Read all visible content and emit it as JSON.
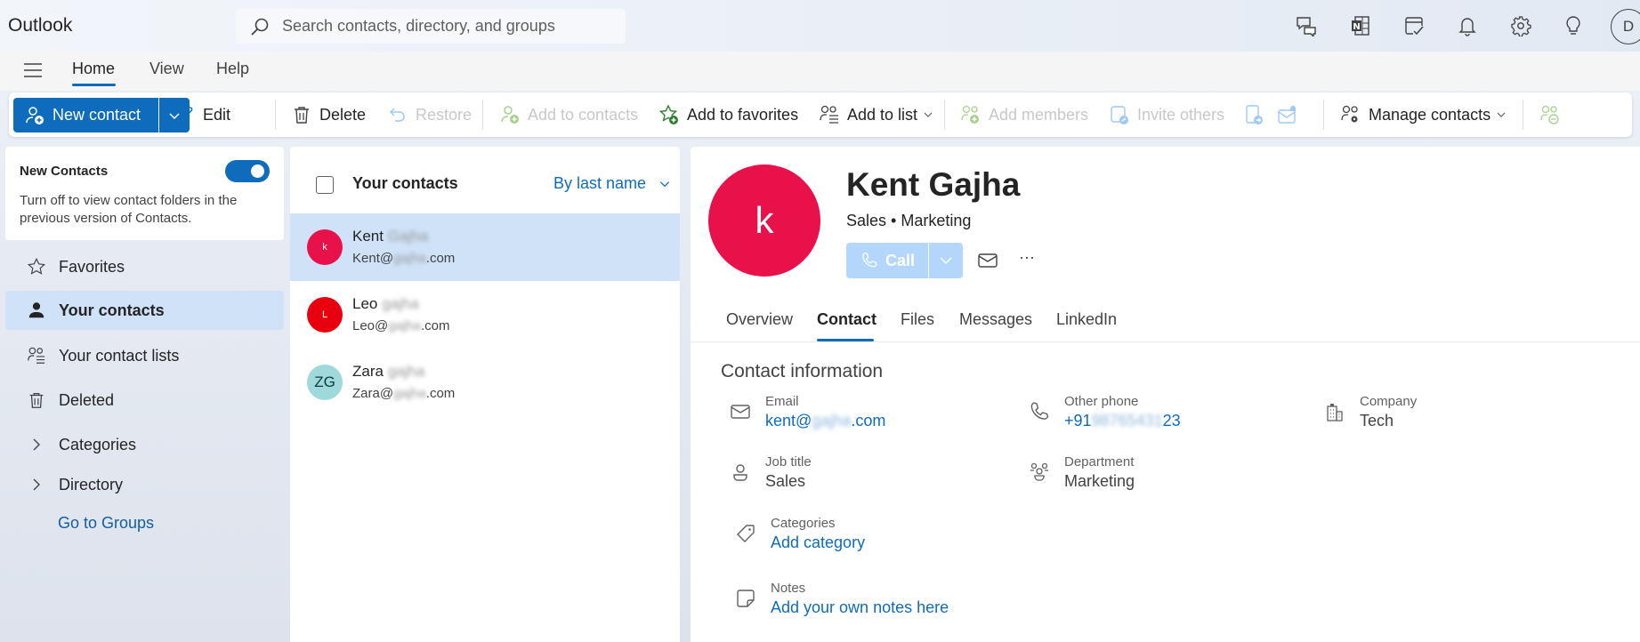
{
  "app": {
    "title": "Outlook"
  },
  "search": {
    "placeholder": "Search contacts, directory, and groups"
  },
  "top_icons": [
    "feedback-icon",
    "onenote-icon",
    "todo-icon",
    "bell-icon",
    "gear-icon",
    "lightbulb-icon"
  ],
  "account": {
    "initial": "D"
  },
  "ribbon_tabs": [
    {
      "label": "Home",
      "active": true
    },
    {
      "label": "View",
      "active": false
    },
    {
      "label": "Help",
      "active": false
    }
  ],
  "toolbar": {
    "new_contact": "New contact",
    "edit": "Edit",
    "delete": "Delete",
    "restore": "Restore",
    "add_to_contacts": "Add to contacts",
    "add_to_favorites": "Add to favorites",
    "add_to_list": "Add to list",
    "add_members": "Add members",
    "invite_others": "Invite others",
    "manage_contacts": "Manage contacts"
  },
  "sidebar": {
    "new_contacts": {
      "title": "New Contacts",
      "description": "Turn off to view contact folders in the previous version of Contacts.",
      "enabled": true
    },
    "items": [
      {
        "label": "Favorites",
        "icon": "star-icon"
      },
      {
        "label": "Your contacts",
        "icon": "person-icon",
        "active": true
      },
      {
        "label": "Your contact lists",
        "icon": "contact-list-icon"
      },
      {
        "label": "Deleted",
        "icon": "trash-icon"
      },
      {
        "label": "Categories",
        "icon": "chevron-right-icon"
      },
      {
        "label": "Directory",
        "icon": "chevron-right-icon"
      }
    ],
    "go_to_groups": "Go to Groups"
  },
  "contact_list": {
    "title": "Your contacts",
    "sort": "By last name",
    "contacts": [
      {
        "first": "Kent",
        "last_blurred": "Gajha",
        "email_user": "Kent@",
        "email_domain_blurred": "gajha",
        "email_tld": ".com",
        "initials": "k",
        "color": "#e8114a",
        "text_color": "#ffffff",
        "selected": true
      },
      {
        "first": "Leo",
        "last_blurred": "gajha",
        "email_user": "Leo@",
        "email_domain_blurred": "gajha",
        "email_tld": ".com",
        "initials": "L",
        "color": "#e8000f",
        "text_color": "#ffffff",
        "selected": false
      },
      {
        "first": "Zara",
        "last_blurred": "gajha",
        "email_user": "Zara@",
        "email_domain_blurred": "gajha",
        "email_tld": ".com",
        "initials": "ZG",
        "color": "#9fd9db",
        "text_color": "#0b3b3d",
        "selected": false
      }
    ]
  },
  "detail": {
    "avatar_initial": "k",
    "name": "Kent Gajha",
    "subtitle": "Sales • Marketing",
    "call_label": "Call",
    "more": "···",
    "tabs": [
      {
        "label": "Overview",
        "active": false
      },
      {
        "label": "Contact",
        "active": true
      },
      {
        "label": "Files",
        "active": false
      },
      {
        "label": "Messages",
        "active": false
      },
      {
        "label": "LinkedIn",
        "active": false
      }
    ],
    "section_title": "Contact information",
    "fields": {
      "email": {
        "label": "Email",
        "prefix": "kent@",
        "blurred": "gajha",
        "suffix": ".com"
      },
      "other_phone": {
        "label": "Other phone",
        "prefix": "+91",
        "blurred": "98765431",
        "suffix": "23"
      },
      "company": {
        "label": "Company",
        "value": "Tech"
      },
      "job_title": {
        "label": "Job title",
        "value": "Sales"
      },
      "department": {
        "label": "Department",
        "value": "Marketing"
      },
      "categories": {
        "label": "Categories",
        "value": "Add category"
      },
      "notes": {
        "label": "Notes",
        "value": "Add your own notes here"
      }
    }
  },
  "colors": {
    "accent": "#0f6cbd",
    "selection": "#cfe2f8",
    "link": "#0f6cbd"
  }
}
